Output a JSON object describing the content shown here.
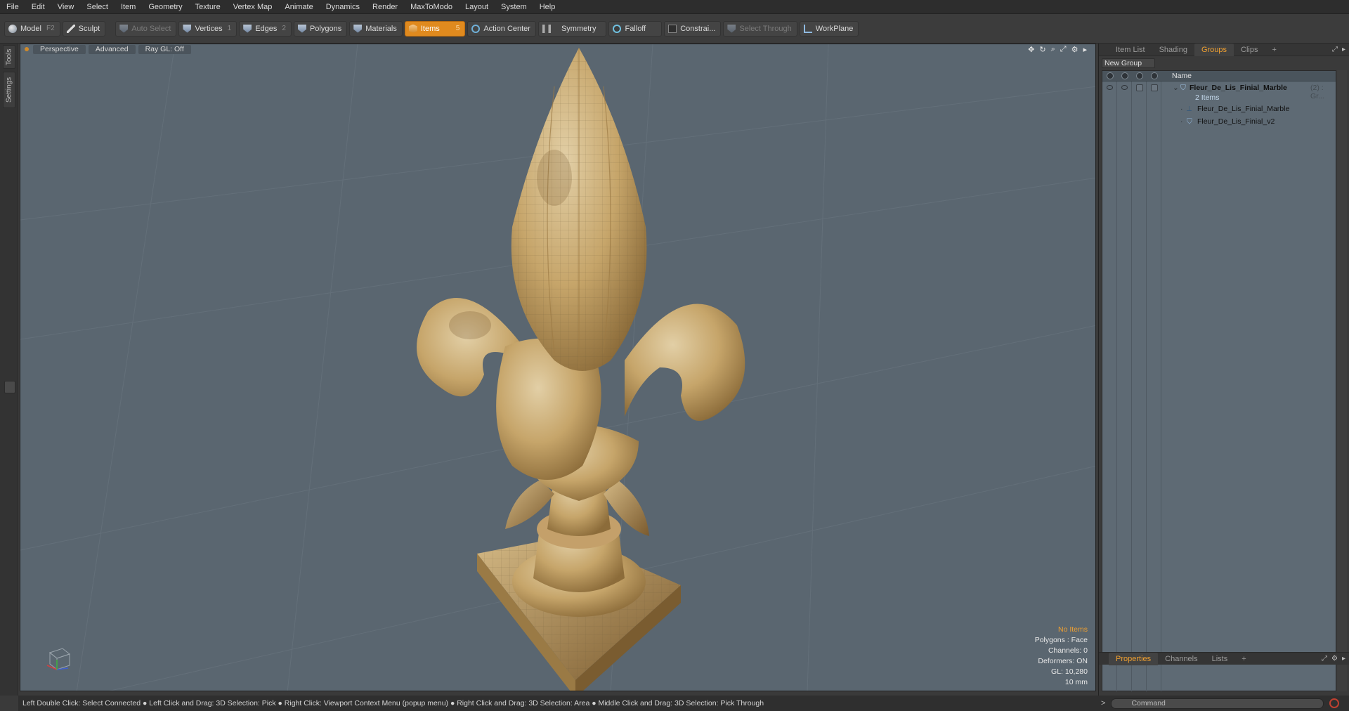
{
  "menu": [
    "File",
    "Edit",
    "View",
    "Select",
    "Item",
    "Geometry",
    "Texture",
    "Vertex Map",
    "Animate",
    "Dynamics",
    "Render",
    "MaxToModo",
    "Layout",
    "System",
    "Help"
  ],
  "toolbar": {
    "model": "Model",
    "model_key": "F2",
    "sculpt": "Sculpt",
    "auto_select": "Auto Select",
    "vertices": "Vertices",
    "vertices_key": "1",
    "edges": "Edges",
    "edges_key": "2",
    "polygons": "Polygons",
    "materials": "Materials",
    "items": "Items",
    "items_key": "5",
    "action_center": "Action Center",
    "symmetry": "Symmetry",
    "falloff": "Falloff",
    "constraints": "Constrai...",
    "select_through": "Select Through",
    "workplane": "WorkPlane"
  },
  "left_tabs": {
    "tools": "Tools",
    "settings": "Settings"
  },
  "viewport": {
    "tabs": [
      "Perspective",
      "Advanced",
      "Ray GL: Off"
    ],
    "info": {
      "selection": "No Items",
      "polygons": "Polygons : Face",
      "channels": "Channels: 0",
      "deformers": "Deformers: ON",
      "gl": "GL: 10,280",
      "scale": "10 mm"
    }
  },
  "right_panel": {
    "tabs": [
      "Item List",
      "Shading",
      "Groups",
      "Clips",
      "+"
    ],
    "active_tab": "Groups",
    "new_group": "New Group",
    "name_header": "Name",
    "group": {
      "name": "Fleur_De_Lis_Finial_Marble",
      "suffix": "(2) : Gr...",
      "count": "2 Items"
    },
    "items": [
      "Fleur_De_Lis_Finial_Marble",
      "Fleur_De_Lis_Finial_v2"
    ],
    "bottom_tabs": [
      "Properties",
      "Channels",
      "Lists",
      "+"
    ],
    "bottom_active": "Properties"
  },
  "status": "Left Double Click: Select Connected ● Left Click and Drag: 3D Selection: Pick ● Right Click: Viewport Context Menu (popup menu) ● Right Click and Drag: 3D Selection: Area ● Middle Click and Drag: 3D Selection: Pick Through",
  "command": {
    "prompt": ">",
    "placeholder": "Command"
  },
  "colors": {
    "accent": "#e08a1e",
    "viewport_bg": "#5a6670",
    "marble": "#c9a86a"
  }
}
